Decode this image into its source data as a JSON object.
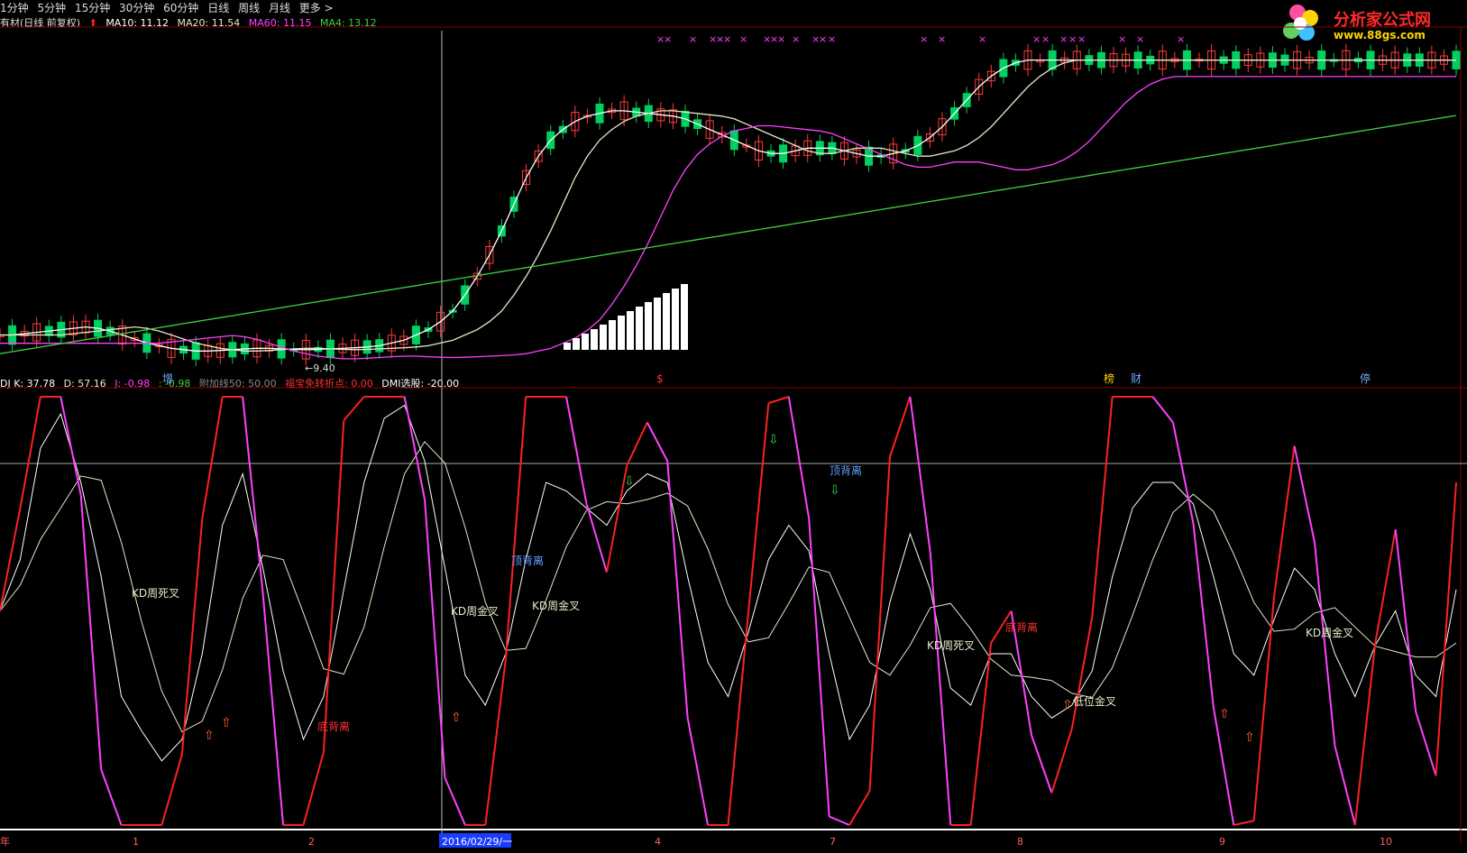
{
  "toolbar": {
    "periods": [
      "1分钟",
      "5分钟",
      "15分钟",
      "30分钟",
      "60分钟",
      "日线",
      "周线",
      "月线",
      "更多 >"
    ]
  },
  "main_legend": {
    "title": "有材(日线 前复权)",
    "ma10": "MA10: 11.12",
    "ma20": "MA20: 11.54",
    "ma60": "MA60: 11.15",
    "ma4": "MA4: 13.12"
  },
  "logo": {
    "name": "分析家公式网",
    "url": "www.88gs.com"
  },
  "annotations_main": [
    "增",
    "$",
    "榜",
    "财",
    "停"
  ],
  "low_label": "9.40",
  "sub_legend": {
    "k": "DJ  K: 37.78",
    "d": "D: 57.16",
    "j": "J: -0.98",
    "x": ": -0.98",
    "extra50": "附加线50: 50.00",
    "extra_turn": "福宝免转折点: 0.00",
    "dmi": "DMI选股: -20.00"
  },
  "sub_labels": [
    {
      "text": "KD周死叉",
      "color": "#e8e8c8"
    },
    {
      "text": "底背离",
      "color": "#ff3030"
    },
    {
      "text": "KD周金叉",
      "color": "#e8e8c8"
    },
    {
      "text": "顶背离",
      "color": "#5fa0ff"
    },
    {
      "text": "KD周金叉",
      "color": "#e8e8c8"
    },
    {
      "text": "顶背离",
      "color": "#5fa0ff"
    },
    {
      "text": "KD周死叉",
      "color": "#e8e8c8"
    },
    {
      "text": "底背离",
      "color": "#ff3030"
    },
    {
      "text": "低位金叉",
      "color": "#e8e8c8"
    },
    {
      "text": "KD周金叉",
      "color": "#e8e8c8"
    }
  ],
  "xaxis": {
    "labels": [
      "年",
      "1",
      "2",
      "2016/02/29/一",
      "4",
      "7",
      "8",
      "9",
      "10"
    ],
    "cursor_label": "2016/02/29/一"
  },
  "colors": {
    "up": "#ff3b3b",
    "down": "#00d060",
    "ma10": "#ffffff",
    "ma20": "#e8e8c8",
    "ma60": "#ff40ff",
    "ma4": "#40d040",
    "k": "#ffffff",
    "d": "#e8e8c8",
    "j_up": "#ff2020",
    "j_down": "#ff40ff",
    "j_cyan": "#40e0e0"
  },
  "chart_data": {
    "type": "line",
    "title": "",
    "xlabel": "",
    "ylabel": "",
    "x": [
      0,
      1,
      2,
      3,
      4,
      5,
      6,
      7,
      8,
      9,
      10,
      11,
      12,
      13,
      14,
      15,
      16,
      17,
      18,
      19,
      20,
      21,
      22,
      23,
      24,
      25,
      26,
      27,
      28,
      29,
      30,
      31,
      32,
      33,
      34,
      35,
      36,
      37,
      38,
      39,
      40,
      41,
      42,
      43,
      44,
      45,
      46,
      47,
      48,
      49,
      50,
      51,
      52,
      53,
      54,
      55,
      56,
      57,
      58,
      59,
      60,
      61,
      62,
      63,
      64,
      65,
      66,
      67,
      68,
      69,
      70,
      71,
      72,
      73,
      74,
      75,
      76,
      77,
      78,
      79,
      80,
      81,
      82,
      83,
      84,
      85,
      86,
      87,
      88,
      89,
      90,
      91,
      92,
      93,
      94,
      95,
      96,
      97,
      98,
      99,
      100,
      101,
      102,
      103,
      104,
      105,
      106,
      107,
      108,
      109,
      110,
      111,
      112,
      113,
      114,
      115,
      116,
      117,
      118,
      119
    ],
    "series": [
      {
        "name": "MA10",
        "values": [
          10.3,
          10.3,
          10.35,
          10.4,
          10.45,
          10.5,
          10.55,
          10.6,
          10.55,
          10.45,
          10.3,
          10.15,
          10.0,
          9.9,
          9.8,
          9.75,
          9.7,
          9.7,
          9.72,
          9.75,
          9.78,
          9.8,
          9.8,
          9.78,
          9.76,
          9.75,
          9.76,
          9.78,
          9.8,
          9.82,
          9.85,
          9.9,
          10.0,
          10.1,
          10.3,
          10.5,
          10.8,
          11.2,
          11.8,
          12.5,
          13.3,
          14.2,
          15.2,
          16.2,
          17.0,
          17.6,
          18.0,
          18.3,
          18.5,
          18.6,
          18.7,
          18.7,
          18.65,
          18.6,
          18.55,
          18.5,
          18.4,
          18.2,
          18.0,
          17.8,
          17.6,
          17.4,
          17.2,
          17.1,
          17.1,
          17.2,
          17.3,
          17.3,
          17.3,
          17.2,
          17.1,
          17.0,
          17.0,
          17.1,
          17.2,
          17.4,
          17.7,
          18.1,
          18.6,
          19.1,
          19.6,
          20.0,
          20.3,
          20.5,
          20.6,
          20.6,
          20.6,
          20.6,
          20.6,
          20.6,
          20.6,
          20.6,
          20.6,
          20.6,
          20.6,
          20.6,
          20.6,
          20.6,
          20.6,
          20.6,
          20.6,
          20.6,
          20.6,
          20.6,
          20.6,
          20.6,
          20.6,
          20.6,
          20.6,
          20.6,
          20.6,
          20.6,
          20.6,
          20.6,
          20.6,
          20.6,
          20.6,
          20.6,
          20.6,
          20.6
        ]
      }
    ]
  }
}
